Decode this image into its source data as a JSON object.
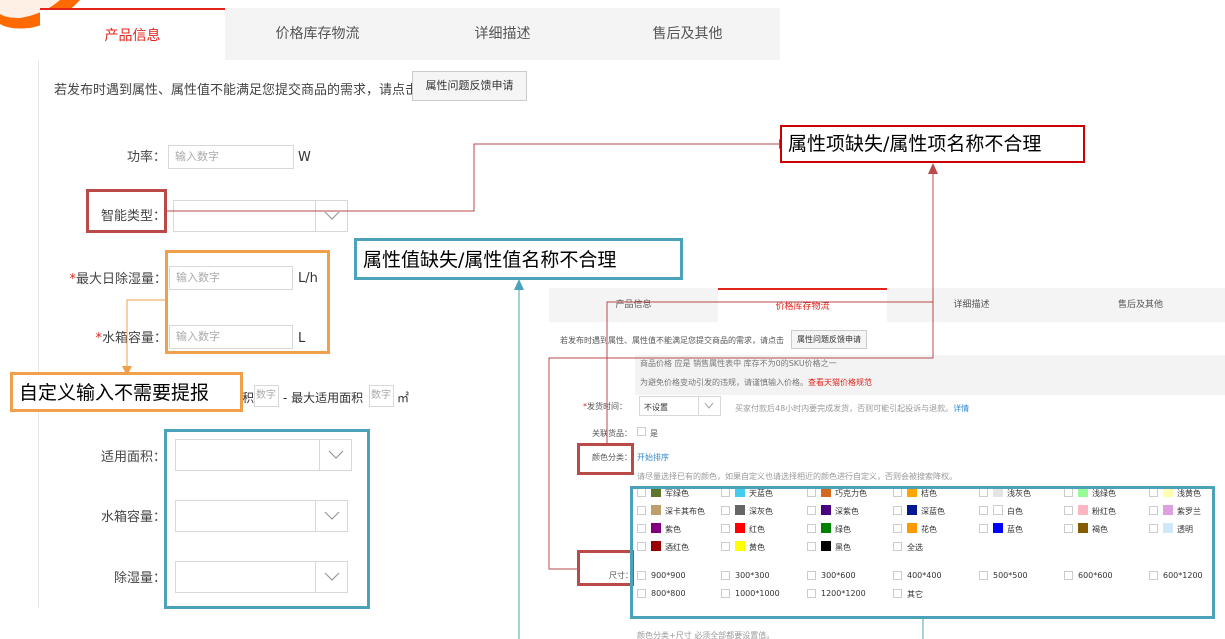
{
  "tabs": [
    "产品信息",
    "价格库存物流",
    "详细描述",
    "售后及其他"
  ],
  "notice": {
    "text": "若发布时遇到属性、属性值不能满足您提交商品的需求，请点击",
    "button": "属性问题反馈申请"
  },
  "fields": {
    "power": {
      "label": "功率：",
      "placeholder": "输入数字",
      "unit": "W"
    },
    "smart_type": {
      "label": "智能类型："
    },
    "dehumid": {
      "label": "最大日除湿量：",
      "placeholder": "输入数字",
      "unit": "L/h"
    },
    "tank": {
      "label": "水箱容量：",
      "placeholder": "输入数字",
      "unit": "L"
    },
    "area": {
      "label_suffix": "积",
      "placeholder1": "数字",
      "mid": "- 最大适用面积",
      "placeholder2": "数字",
      "unit": "㎡"
    },
    "applicable_area": {
      "label": "适用面积："
    },
    "tank2": {
      "label": "水箱容量："
    },
    "dehumid2": {
      "label": "除湿量："
    }
  },
  "callouts": {
    "attr_missing": "属性项缺失/属性项名称不合理",
    "value_missing": "属性值缺失/属性值名称不合理",
    "custom_input": "自定义输入不需要提报"
  },
  "right": {
    "tabs": [
      "产品信息",
      "价格库存物流",
      "详细描述",
      "售后及其他"
    ],
    "notice": "若发布时遇到属性、属性值不能满足您提交商品的需求，请点击",
    "button": "属性问题反馈申请",
    "price_note1": "商品价格 应是 销售属性表中 库存不为0的SKU价格之一",
    "price_note2": "为避免价格变动引发的违规，请谨慎输入价格。",
    "price_link": "查看天猫价格规范",
    "ship_label": "发货时间：",
    "ship_value": "不设置",
    "ship_note": "买家付款后48小时内要完成发货，否则可能引起投诉与退款。",
    "ship_link": "详情",
    "related_label": "关联货品：",
    "related_value": "是",
    "color_label": "颜色分类：",
    "color_sort": "开始排序",
    "color_hint": "请尽量选择已有的颜色，如果自定义也请选择相近的颜色进行自定义，否则会被搜索降权。",
    "colors": [
      {
        "name": "军绿色",
        "hex": "#5d762a"
      },
      {
        "name": "天蓝色",
        "hex": "#44ccee"
      },
      {
        "name": "巧克力色",
        "hex": "#d2691e"
      },
      {
        "name": "桔色",
        "hex": "#ffa500"
      },
      {
        "name": "浅灰色",
        "hex": "#e4e4e4"
      },
      {
        "name": "浅绿色",
        "hex": "#98fb98"
      },
      {
        "name": "浅黄色",
        "hex": "#ffffb1"
      },
      {
        "name": "深卡其布色",
        "hex": "#bd9f6b"
      },
      {
        "name": "深灰色",
        "hex": "#666666"
      },
      {
        "name": "深紫色",
        "hex": "#4b0082"
      },
      {
        "name": "深蓝色",
        "hex": "#041690"
      },
      {
        "name": "白色",
        "hex": "#ffffff"
      },
      {
        "name": "粉红色",
        "hex": "#ffb6c1"
      },
      {
        "name": "紫罗兰",
        "hex": "#dda0dd"
      },
      {
        "name": "紫色",
        "hex": "#800080"
      },
      {
        "name": "红色",
        "hex": "#ff0000"
      },
      {
        "name": "绿色",
        "hex": "#008000"
      },
      {
        "name": "花色",
        "hex": "#ff9900"
      },
      {
        "name": "蓝色",
        "hex": "#0000fe"
      },
      {
        "name": "褐色",
        "hex": "#855b00"
      },
      {
        "name": "透明",
        "hex": "#cfe8f8"
      },
      {
        "name": "酒红色",
        "hex": "#990000"
      },
      {
        "name": "黄色",
        "hex": "#ffff00"
      },
      {
        "name": "黑色",
        "hex": "#000000"
      },
      {
        "name": "全选",
        "hex": ""
      }
    ],
    "size_label": "尺寸：",
    "sizes": [
      "900*900",
      "300*300",
      "300*600",
      "400*400",
      "500*500",
      "600*600",
      "600*1200",
      "800*800",
      "1000*1000",
      "1200*1200",
      "其它"
    ],
    "footer": "颜色分类+尺寸 必须全部都要设置值。"
  },
  "colors": {
    "accent": "#e2231a",
    "red_box": "#b94a48",
    "teal_box": "#4aa3b8",
    "orange_box": "#f0a04b",
    "callout_red": "#cc0000"
  }
}
